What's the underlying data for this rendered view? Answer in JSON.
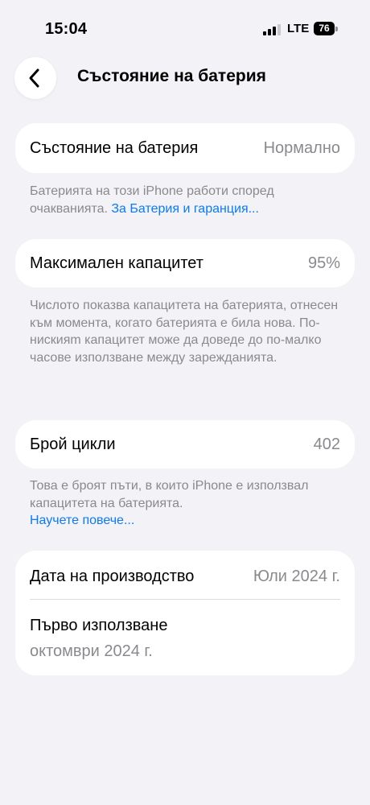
{
  "status": {
    "time": "15:04",
    "network": "LTE",
    "battery": "76"
  },
  "nav": {
    "title": "Състояние на батерия"
  },
  "health": {
    "label": "Състояние на батерия",
    "value": "Нормално",
    "footer_text": "Батерията на този iPhone работи според очакванията.",
    "footer_link": "За Батерия и гаранция..."
  },
  "capacity": {
    "label": "Максимален капацитет",
    "value": "95%",
    "footer_text": "Числото показва капацитета на батерията, отнесен към момента, когато батерията е била нова. По-нискияm капацитет може да доведе до по-малко часове използване между зарежданията."
  },
  "cycles": {
    "label": "Брой цикли",
    "value": "402",
    "footer_text": "Това е броят пъти, в които iPhone е използвал капацитета на батерията.",
    "footer_link": "Научете повече..."
  },
  "dates": {
    "manufacture_label": "Дата на производство",
    "manufacture_value": "Юли 2024 г.",
    "first_use_label": "Първо използване",
    "first_use_value": "октомври 2024 г."
  }
}
